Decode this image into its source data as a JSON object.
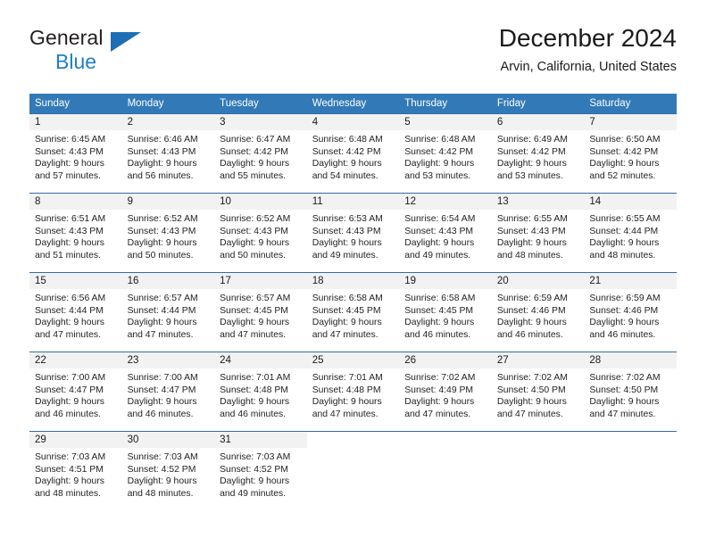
{
  "brand": {
    "name_part1": "General",
    "name_part2": "Blue",
    "flag_icon": "triangle-flag-icon"
  },
  "header": {
    "title": "December 2024",
    "location": "Arvin, California, United States"
  },
  "colors": {
    "header_blue": "#3279b7",
    "row_border_blue": "#2e6da4",
    "daynum_band": "#f2f2f2",
    "brand_blue": "#1f7fc4"
  },
  "weekday_headers": [
    "Sunday",
    "Monday",
    "Tuesday",
    "Wednesday",
    "Thursday",
    "Friday",
    "Saturday"
  ],
  "weeks": [
    [
      {
        "day": "1",
        "sunrise": "Sunrise: 6:45 AM",
        "sunset": "Sunset: 4:43 PM",
        "daylight1": "Daylight: 9 hours",
        "daylight2": "and 57 minutes."
      },
      {
        "day": "2",
        "sunrise": "Sunrise: 6:46 AM",
        "sunset": "Sunset: 4:43 PM",
        "daylight1": "Daylight: 9 hours",
        "daylight2": "and 56 minutes."
      },
      {
        "day": "3",
        "sunrise": "Sunrise: 6:47 AM",
        "sunset": "Sunset: 4:42 PM",
        "daylight1": "Daylight: 9 hours",
        "daylight2": "and 55 minutes."
      },
      {
        "day": "4",
        "sunrise": "Sunrise: 6:48 AM",
        "sunset": "Sunset: 4:42 PM",
        "daylight1": "Daylight: 9 hours",
        "daylight2": "and 54 minutes."
      },
      {
        "day": "5",
        "sunrise": "Sunrise: 6:48 AM",
        "sunset": "Sunset: 4:42 PM",
        "daylight1": "Daylight: 9 hours",
        "daylight2": "and 53 minutes."
      },
      {
        "day": "6",
        "sunrise": "Sunrise: 6:49 AM",
        "sunset": "Sunset: 4:42 PM",
        "daylight1": "Daylight: 9 hours",
        "daylight2": "and 53 minutes."
      },
      {
        "day": "7",
        "sunrise": "Sunrise: 6:50 AM",
        "sunset": "Sunset: 4:42 PM",
        "daylight1": "Daylight: 9 hours",
        "daylight2": "and 52 minutes."
      }
    ],
    [
      {
        "day": "8",
        "sunrise": "Sunrise: 6:51 AM",
        "sunset": "Sunset: 4:43 PM",
        "daylight1": "Daylight: 9 hours",
        "daylight2": "and 51 minutes."
      },
      {
        "day": "9",
        "sunrise": "Sunrise: 6:52 AM",
        "sunset": "Sunset: 4:43 PM",
        "daylight1": "Daylight: 9 hours",
        "daylight2": "and 50 minutes."
      },
      {
        "day": "10",
        "sunrise": "Sunrise: 6:52 AM",
        "sunset": "Sunset: 4:43 PM",
        "daylight1": "Daylight: 9 hours",
        "daylight2": "and 50 minutes."
      },
      {
        "day": "11",
        "sunrise": "Sunrise: 6:53 AM",
        "sunset": "Sunset: 4:43 PM",
        "daylight1": "Daylight: 9 hours",
        "daylight2": "and 49 minutes."
      },
      {
        "day": "12",
        "sunrise": "Sunrise: 6:54 AM",
        "sunset": "Sunset: 4:43 PM",
        "daylight1": "Daylight: 9 hours",
        "daylight2": "and 49 minutes."
      },
      {
        "day": "13",
        "sunrise": "Sunrise: 6:55 AM",
        "sunset": "Sunset: 4:43 PM",
        "daylight1": "Daylight: 9 hours",
        "daylight2": "and 48 minutes."
      },
      {
        "day": "14",
        "sunrise": "Sunrise: 6:55 AM",
        "sunset": "Sunset: 4:44 PM",
        "daylight1": "Daylight: 9 hours",
        "daylight2": "and 48 minutes."
      }
    ],
    [
      {
        "day": "15",
        "sunrise": "Sunrise: 6:56 AM",
        "sunset": "Sunset: 4:44 PM",
        "daylight1": "Daylight: 9 hours",
        "daylight2": "and 47 minutes."
      },
      {
        "day": "16",
        "sunrise": "Sunrise: 6:57 AM",
        "sunset": "Sunset: 4:44 PM",
        "daylight1": "Daylight: 9 hours",
        "daylight2": "and 47 minutes."
      },
      {
        "day": "17",
        "sunrise": "Sunrise: 6:57 AM",
        "sunset": "Sunset: 4:45 PM",
        "daylight1": "Daylight: 9 hours",
        "daylight2": "and 47 minutes."
      },
      {
        "day": "18",
        "sunrise": "Sunrise: 6:58 AM",
        "sunset": "Sunset: 4:45 PM",
        "daylight1": "Daylight: 9 hours",
        "daylight2": "and 47 minutes."
      },
      {
        "day": "19",
        "sunrise": "Sunrise: 6:58 AM",
        "sunset": "Sunset: 4:45 PM",
        "daylight1": "Daylight: 9 hours",
        "daylight2": "and 46 minutes."
      },
      {
        "day": "20",
        "sunrise": "Sunrise: 6:59 AM",
        "sunset": "Sunset: 4:46 PM",
        "daylight1": "Daylight: 9 hours",
        "daylight2": "and 46 minutes."
      },
      {
        "day": "21",
        "sunrise": "Sunrise: 6:59 AM",
        "sunset": "Sunset: 4:46 PM",
        "daylight1": "Daylight: 9 hours",
        "daylight2": "and 46 minutes."
      }
    ],
    [
      {
        "day": "22",
        "sunrise": "Sunrise: 7:00 AM",
        "sunset": "Sunset: 4:47 PM",
        "daylight1": "Daylight: 9 hours",
        "daylight2": "and 46 minutes."
      },
      {
        "day": "23",
        "sunrise": "Sunrise: 7:00 AM",
        "sunset": "Sunset: 4:47 PM",
        "daylight1": "Daylight: 9 hours",
        "daylight2": "and 46 minutes."
      },
      {
        "day": "24",
        "sunrise": "Sunrise: 7:01 AM",
        "sunset": "Sunset: 4:48 PM",
        "daylight1": "Daylight: 9 hours",
        "daylight2": "and 46 minutes."
      },
      {
        "day": "25",
        "sunrise": "Sunrise: 7:01 AM",
        "sunset": "Sunset: 4:48 PM",
        "daylight1": "Daylight: 9 hours",
        "daylight2": "and 47 minutes."
      },
      {
        "day": "26",
        "sunrise": "Sunrise: 7:02 AM",
        "sunset": "Sunset: 4:49 PM",
        "daylight1": "Daylight: 9 hours",
        "daylight2": "and 47 minutes."
      },
      {
        "day": "27",
        "sunrise": "Sunrise: 7:02 AM",
        "sunset": "Sunset: 4:50 PM",
        "daylight1": "Daylight: 9 hours",
        "daylight2": "and 47 minutes."
      },
      {
        "day": "28",
        "sunrise": "Sunrise: 7:02 AM",
        "sunset": "Sunset: 4:50 PM",
        "daylight1": "Daylight: 9 hours",
        "daylight2": "and 47 minutes."
      }
    ],
    [
      {
        "day": "29",
        "sunrise": "Sunrise: 7:03 AM",
        "sunset": "Sunset: 4:51 PM",
        "daylight1": "Daylight: 9 hours",
        "daylight2": "and 48 minutes."
      },
      {
        "day": "30",
        "sunrise": "Sunrise: 7:03 AM",
        "sunset": "Sunset: 4:52 PM",
        "daylight1": "Daylight: 9 hours",
        "daylight2": "and 48 minutes."
      },
      {
        "day": "31",
        "sunrise": "Sunrise: 7:03 AM",
        "sunset": "Sunset: 4:52 PM",
        "daylight1": "Daylight: 9 hours",
        "daylight2": "and 49 minutes."
      },
      {
        "day": "",
        "sunrise": "",
        "sunset": "",
        "daylight1": "",
        "daylight2": ""
      },
      {
        "day": "",
        "sunrise": "",
        "sunset": "",
        "daylight1": "",
        "daylight2": ""
      },
      {
        "day": "",
        "sunrise": "",
        "sunset": "",
        "daylight1": "",
        "daylight2": ""
      },
      {
        "day": "",
        "sunrise": "",
        "sunset": "",
        "daylight1": "",
        "daylight2": ""
      }
    ]
  ]
}
